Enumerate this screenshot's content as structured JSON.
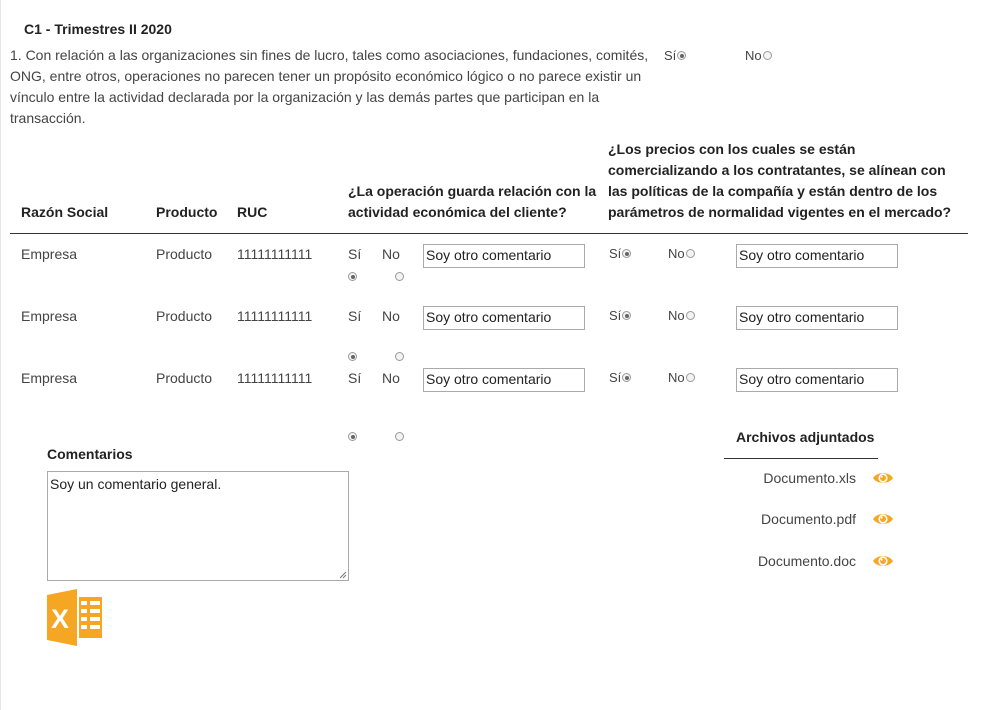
{
  "section_title": "C1 - Trimestres II 2020",
  "question": {
    "text": "1. Con relación a las organizaciones sin fines de lucro, tales como asociaciones, fundaciones, comités, ONG, entre otros, operaciones no parecen tener un propósito económico lógico o no parece existir un vínculo entre la actividad declarada por la organización y las demás partes que participan en la transacción.",
    "yes_label": "Sí",
    "no_label": "No",
    "selected": "yes"
  },
  "table": {
    "headers": {
      "razon_social": "Razón Social",
      "producto": "Producto",
      "ruc": "RUC",
      "q1": "¿La operación guarda relación con la actividad económica del cliente?",
      "q2": "¿Los precios con los cuales se están comercializando a los contratantes, se alínean con las políticas de la compañía y están dentro de los parámetros de normalidad vigentes en el mercado?"
    },
    "yes_label": "Sí",
    "no_label": "No",
    "rows": [
      {
        "razon_social": "Empresa",
        "producto": "Producto",
        "ruc": "11111111111",
        "q1_selected": "yes",
        "q1_comment": "Soy otro comentario",
        "q2_selected": "yes",
        "q2_comment": "Soy otro comentario"
      },
      {
        "razon_social": "Empresa",
        "producto": "Producto",
        "ruc": "11111111111",
        "q1_selected": "yes",
        "q1_comment": "Soy otro comentario",
        "q2_selected": "yes",
        "q2_comment": "Soy otro comentario"
      },
      {
        "razon_social": "Empresa",
        "producto": "Producto",
        "ruc": "11111111111",
        "q1_selected": "yes",
        "q1_comment": "Soy otro comentario",
        "q2_selected": "yes",
        "q2_comment": "Soy otro comentario"
      }
    ]
  },
  "comments": {
    "label": "Comentarios",
    "value": "Soy un comentario general."
  },
  "attachments": {
    "label": "Archivos adjuntados",
    "files": [
      "Documento.xls",
      "Documento.pdf",
      "Documento.doc"
    ],
    "icon": "eye-icon",
    "icon_color": "#f5a623"
  },
  "excel_icon": {
    "name": "excel-icon",
    "color": "#f5a623"
  }
}
